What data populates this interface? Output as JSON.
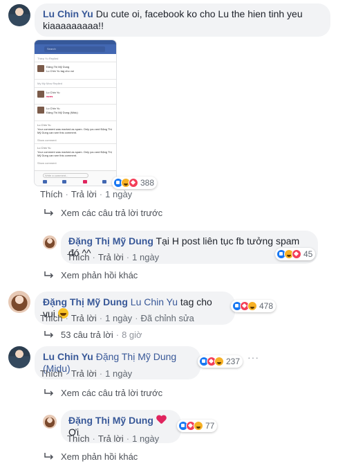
{
  "comments": [
    {
      "author": "Lu Chin Yu",
      "text": "Du cute oi, facebook ko cho Lu the hien tinh yeu kiaaaaaaaaa!!",
      "like": "Thích",
      "reply": "Trả lời",
      "time": "1 ngày",
      "reactions": "388",
      "reactions_icons": [
        "like-icon",
        "haha-icon",
        "love-icon"
      ],
      "view_previous": "Xem các câu trả lời trước",
      "screenshot": {
        "search": "Search",
        "rows": [
          "Thiep Yu Replied",
          "Đặng Thị Mỹ Dung",
          "Lu Chin Yu tag cho vui",
          "My My Mow Replied",
          "Lu Chin Yu",
          "Lu Chin Yu",
          "Đặng Thị Mỹ Dung (Midu)",
          "Lu Chin Yu",
          "Your comment was marked as spam. Only you and Đặng Thị Mỹ Dung can see this comment.",
          "Show comment",
          "Lu Chin Yu",
          "Your comment was marked as spam. Only you and Đặng Thị Mỹ Dung can see this comment.",
          "Show comment"
        ],
        "input_placeholder": "Write a comment..."
      }
    },
    {
      "author": "Đặng Thị Mỹ Dung",
      "text": "Tại H post liên tục fb tưởng spam đó ^^",
      "like": "Thích",
      "reply": "Trả lời",
      "time": "1 ngày",
      "reactions": "45",
      "more_replies": "Xem phản hồi khác"
    },
    {
      "author": "Đặng Thị Mỹ Dung",
      "mention": "Lu Chin Yu",
      "text": "tag cho vui",
      "like": "Thích",
      "reply": "Trả lời",
      "time": "1 ngày",
      "edited": "Đã chỉnh sửa",
      "reactions": "478",
      "replies_count": "53 câu trả lời",
      "replies_time": "8 giờ"
    },
    {
      "author": "Lu Chin Yu",
      "mention": "Đặng Thị Mỹ Dung (Midu)",
      "like": "Thích",
      "reply": "Trả lời",
      "time": "1 ngày",
      "reactions": "237",
      "more": "···",
      "view_previous": "Xem các câu trả lời trước"
    },
    {
      "author": "Đặng Thị Mỹ Dung",
      "text": "Ơi",
      "like": "Thích",
      "reply": "Trả lời",
      "time": "1 ngày",
      "reactions": "77",
      "more_replies": "Xem phản hồi khác"
    }
  ],
  "colors": {
    "name": "#385898",
    "bubble": "#f2f3f5",
    "like": "#1877f2",
    "love": "#f33e58",
    "haha": "#f7b125"
  }
}
